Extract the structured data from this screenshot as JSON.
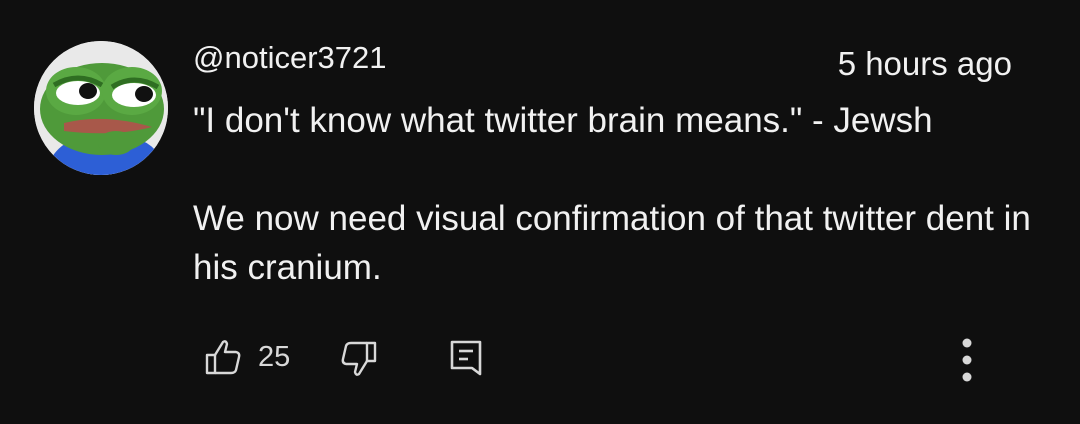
{
  "comment": {
    "username": "@noticer3721",
    "timestamp": "5 hours ago",
    "paragraphs": [
      "\"I don't know what twitter brain means.\" - Jewsh",
      "We now need visual confirmation of that twitter dent in his cranium."
    ],
    "likes": "25"
  },
  "icons": {
    "avatar": "frog-avatar",
    "like": "thumbs-up-icon",
    "dislike": "thumbs-down-icon",
    "reply": "reply-icon",
    "more": "more-vertical-icon"
  },
  "colors": {
    "background": "#0f0f0f",
    "text": "#f1f1f1",
    "icon": "#d8d8d8"
  }
}
